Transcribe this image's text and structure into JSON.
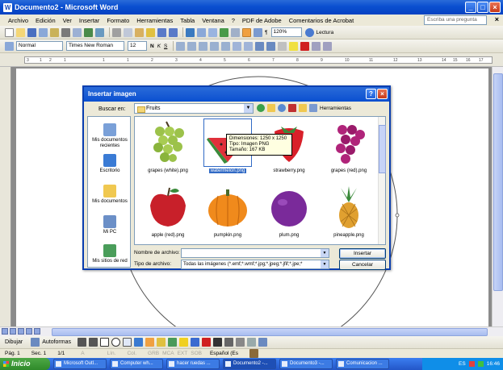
{
  "window": {
    "title": "Documento2 - Microsoft Word",
    "min": "_",
    "max": "□",
    "close": "×"
  },
  "menu": {
    "items": [
      "Archivo",
      "Edición",
      "Ver",
      "Insertar",
      "Formato",
      "Herramientas",
      "Tabla",
      "Ventana",
      "?",
      "PDF de Adobe",
      "Comentarios de Acrobat"
    ],
    "help_placeholder": "Escriba una pregunta",
    "close_doc": "×"
  },
  "toolbar": {
    "zoom": "120%",
    "read_label": "Lectura",
    "style": "Normal",
    "font": "Times New Roman",
    "font_size": "12",
    "bold": "N",
    "italic": "K",
    "underline": "S"
  },
  "ruler": {
    "marks": [
      "3",
      "1",
      "2",
      "1",
      "1",
      "1",
      "2",
      "3",
      "4",
      "5",
      "6",
      "7",
      "8",
      "9",
      "10",
      "11",
      "12",
      "13",
      "14",
      "15",
      "16",
      "17"
    ]
  },
  "dialog": {
    "title": "Insertar imagen",
    "help_btn": "?",
    "close_btn": "×",
    "look_in_label": "Buscar en:",
    "look_in_value": "Fruits",
    "tools_label": "Herramientas",
    "places": [
      {
        "label": "Mis documentos recientes",
        "color": "#7aa0d8"
      },
      {
        "label": "Escritorio",
        "color": "#3a7bd5"
      },
      {
        "label": "Mis documentos",
        "color": "#f0c850"
      },
      {
        "label": "Mi PC",
        "color": "#6b8fc7"
      },
      {
        "label": "Mis sitios de red",
        "color": "#4a9d5a"
      }
    ],
    "files": [
      {
        "name": "grapes (white).png",
        "icon": "white-grapes",
        "color": "#9cc24a"
      },
      {
        "name": "watermelon.png",
        "icon": "watermelon",
        "color": "#e0303a"
      },
      {
        "name": "strawberry.png",
        "icon": "strawberry",
        "color": "#d8202a"
      },
      {
        "name": "grapes (red).png",
        "icon": "red-grapes",
        "color": "#b0247a"
      },
      {
        "name": "apple (red).png",
        "icon": "red-apple",
        "color": "#c8202a"
      },
      {
        "name": "pumpkin.png",
        "icon": "pumpkin",
        "color": "#f08a1c"
      },
      {
        "name": "plum.png",
        "icon": "plum",
        "color": "#7a2a9a"
      },
      {
        "name": "pineapple.png",
        "icon": "pineapple",
        "color": "#e0a030"
      }
    ],
    "tooltip": {
      "dims": "Dimensiones: 1250 x 1250",
      "type": "Tipo: Imagen PNG",
      "size": "Tamaño: 167 KB"
    },
    "filename_label": "Nombre de archivo:",
    "filename_value": "",
    "filetype_label": "Tipo de archivo:",
    "filetype_value": "Todas las imágenes (*.emf;*.wmf;*.jpg;*.jpeg;*.jfif;*.jpe;*",
    "insert_label": "Insertar",
    "cancel_label": "Cancelar"
  },
  "drawbar": {
    "draw_label": "Dibujar",
    "autoshapes_label": "Autoformas"
  },
  "status": {
    "page": "Pág. 1",
    "section": "Sec. 1",
    "pages": "1/1",
    "at": "A",
    "line": "Lín.",
    "col": "Col.",
    "modes": [
      "GRB",
      "MCA",
      "EXT",
      "SOB"
    ],
    "lang": "Español (Es"
  },
  "taskbar": {
    "start": "Inicio",
    "tasks": [
      "Microsoft Outl...",
      "Computer wh...",
      "hacer ruedas ...",
      "Documento2 -...",
      "Documento3 -...",
      "Comunicacion ..."
    ],
    "lang": "ES",
    "time": "16:46"
  }
}
